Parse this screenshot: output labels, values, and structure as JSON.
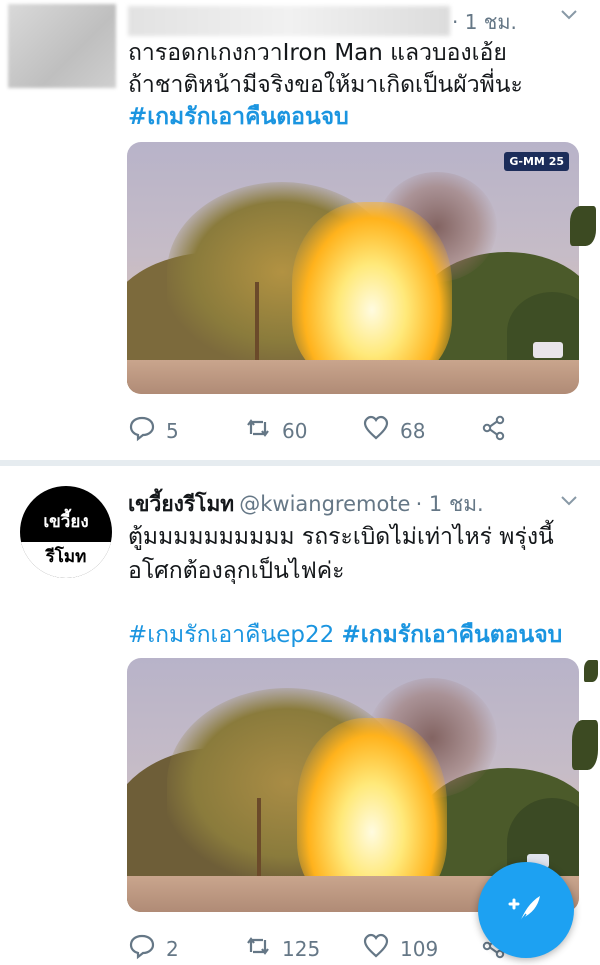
{
  "tweets": [
    {
      "time": "· 1 ชม.",
      "lines": [
        "ถารอดกเกงกวาIron Man แลวบองเอ้ย",
        "ถ้าชาติหน้ามีจริงขอให้มาเกิดเป็นผัวพี่นะ"
      ],
      "hashtag": "#เกมรักเอาคืนตอนจบ",
      "media_logo": "G-MM 25",
      "actions": {
        "reply_count": "5",
        "retweet_count": "60",
        "like_count": "68"
      }
    },
    {
      "display_name": "เขวี้ยงรีโมท",
      "handle": "@kwiangremote",
      "time": "· 1 ชม.",
      "avatar_line1": "เขวี้ยง",
      "avatar_line2": "รีโมท",
      "lines": [
        "ตู้มมมมมมมมมม รถระเบิดไม่เท่าไหร่ พรุ่งนี้",
        "อโศกต้องลุกเป็นไฟค่ะ"
      ],
      "hashtag_1": "#เกมรักเอาคืนep22",
      "hashtag_2": "#เกมรักเอาคืนตอนจบ",
      "actions": {
        "reply_count": "2",
        "retweet_count": "125",
        "like_count": "109"
      }
    }
  ],
  "icons": {
    "reply": "reply-icon",
    "retweet": "retweet-icon",
    "like": "heart-icon",
    "share": "share-icon",
    "chevron": "chevron-down-icon",
    "compose": "compose-feather-icon"
  },
  "colors": {
    "accent": "#1da1f2",
    "hashtag": "#1b95e0",
    "meta": "#657786"
  }
}
